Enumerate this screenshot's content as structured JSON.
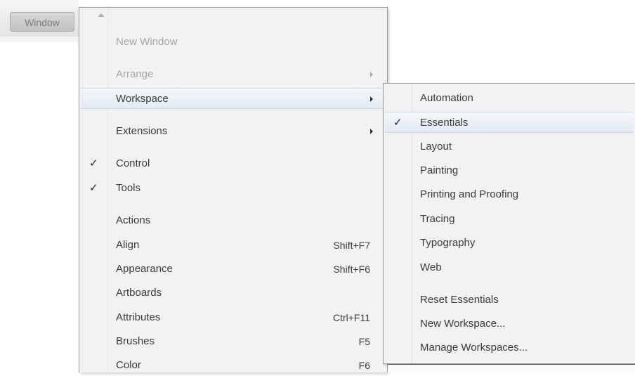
{
  "menubar": {
    "window_label": "Window"
  },
  "main_menu": {
    "items": [
      {
        "label": "New Window",
        "disabled": true
      },
      {
        "label": "Arrange",
        "disabled": true,
        "submenu": true
      },
      {
        "label": "Workspace",
        "submenu": true,
        "highlighted": true
      },
      {
        "label": "Extensions",
        "submenu": true
      },
      {
        "label": "Control",
        "checked": true,
        "check": "✓"
      },
      {
        "label": "Tools",
        "checked": true,
        "check": "✓"
      },
      {
        "label": "Actions"
      },
      {
        "label": "Align",
        "shortcut": "Shift+F7"
      },
      {
        "label": "Appearance",
        "shortcut": "Shift+F6"
      },
      {
        "label": "Artboards"
      },
      {
        "label": "Attributes",
        "shortcut": "Ctrl+F11"
      },
      {
        "label": "Brushes",
        "shortcut": "F5"
      },
      {
        "label": "Color",
        "shortcut": "F6"
      }
    ]
  },
  "workspace_submenu": {
    "items": [
      {
        "label": "Automation"
      },
      {
        "label": "Essentials",
        "checked": true,
        "check": "✓",
        "highlighted": true
      },
      {
        "label": "Layout"
      },
      {
        "label": "Painting"
      },
      {
        "label": "Printing and Proofing"
      },
      {
        "label": "Tracing"
      },
      {
        "label": "Typography"
      },
      {
        "label": "Web"
      },
      {
        "label": "Reset Essentials"
      },
      {
        "label": "New Workspace..."
      },
      {
        "label": "Manage Workspaces..."
      }
    ]
  }
}
